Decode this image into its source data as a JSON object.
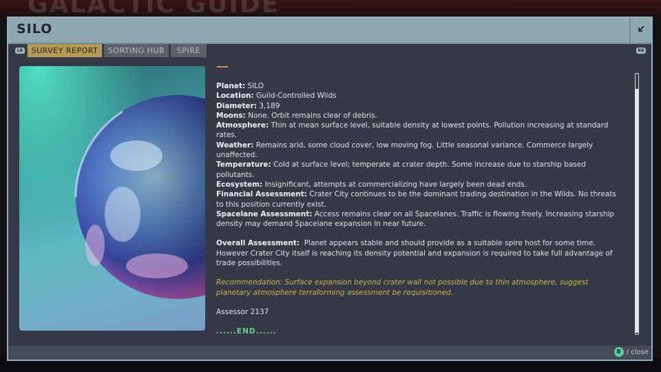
{
  "background": {
    "ghost_title": "GALACTIC GUIDE"
  },
  "window": {
    "title": "SILO",
    "collapse_icon": "arrow-down-left-icon"
  },
  "tabs": {
    "left_bumper": "LB",
    "right_bumper": "RB",
    "items": [
      {
        "label": "SURVEY REPORT",
        "active": true
      },
      {
        "label": "SORTING HUB",
        "active": false
      },
      {
        "label": "SPIRE",
        "active": false
      }
    ]
  },
  "report": {
    "fields": [
      {
        "label": "Planet:",
        "value": " SILO"
      },
      {
        "label": "Location:",
        "value": " Guild-Controlled Wilds"
      },
      {
        "label": "Diameter:",
        "value": " 3,189"
      },
      {
        "label": "Moons:",
        "value": " None. Orbit remains clear of debris."
      },
      {
        "label": "Atmosphere:",
        "value": " Thin at mean surface level, suitable density at lowest points. Pollution increasing at standard rates."
      },
      {
        "label": "Weather:",
        "value": " Remains arid, some cloud cover, low moving fog. Little seasonal variance. Commerce largely unaffected."
      },
      {
        "label": "Temperature:",
        "value": " Cold at surface level; temperate at crater depth. Some increase due to starship based pollutants."
      },
      {
        "label": "Ecosystem:",
        "value": " Insignificant, attempts at commercializing have largely been dead ends."
      },
      {
        "label": "Financial Assessment:",
        "value": " Crater City continues to be the dominant trading destination in the Wilds. No threats to this position currently exist."
      },
      {
        "label": "Spacelane Assessment:",
        "value": " Access remains clear on all Spacelanes. Traffic is flowing freely. Increasing starship density may demand Spacelane expansion in near future."
      }
    ],
    "overall": {
      "label": "Overall Assessment:",
      "value": "  Planet appears stable and should provide as a suitable spire host for some time. However Crater City itself is reaching its density potential and expansion is required to take full advantage of trade possibilities."
    },
    "recommendation": "Recommendation: Surface expansion beyond crater wall not possible due to thin atmosphere, suggest planetary atmosphere terraforming assessment be requisitioned.",
    "assessor": "Assessor 2137",
    "end_marker": "......END......"
  },
  "footer": {
    "button_glyph": "B",
    "close_label": "/ close"
  },
  "colors": {
    "panel": "#353a46",
    "frame": "#8fa9b0",
    "active_tab": "#b39a57",
    "recommendation": "#c8b44c",
    "end_marker": "#5fcf9a"
  }
}
